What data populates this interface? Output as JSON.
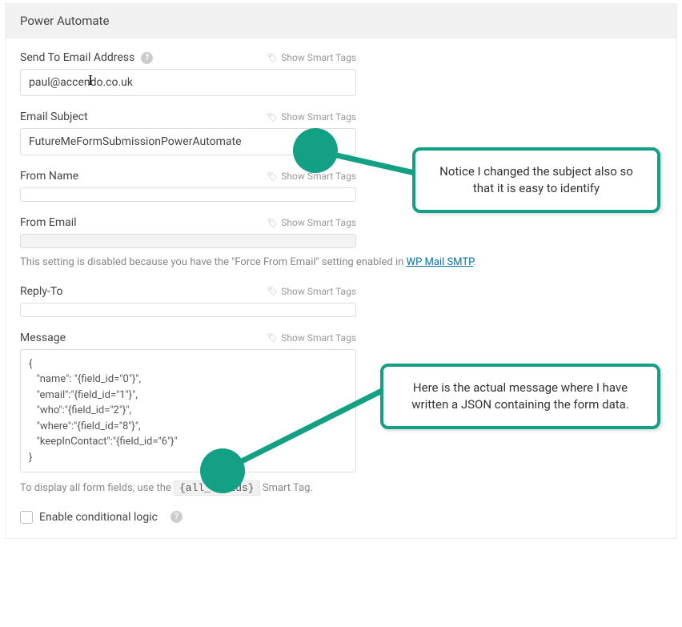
{
  "panel": {
    "title": "Power Automate"
  },
  "smartTagsLabel": "Show Smart Tags",
  "fields": {
    "sendTo": {
      "label": "Send To Email Address",
      "value": "paul@accendo.co.uk"
    },
    "subject": {
      "label": "Email Subject",
      "value": "FutureMeFormSubmissionPowerAutomate"
    },
    "fromName": {
      "label": "From Name",
      "value": ""
    },
    "fromEmail": {
      "label": "From Email",
      "value": "",
      "hintPrefix": "This setting is disabled because you have the \"Force From Email\" setting enabled in ",
      "hintLink": "WP Mail SMTP",
      "hintSuffix": "."
    },
    "replyTo": {
      "label": "Reply-To",
      "value": ""
    },
    "message": {
      "label": "Message",
      "value": "{\n   \"name\": \"{field_id=\"0\"}\",\n   \"email\":\"{field_id=\"1\"}\",\n   \"who\":\"{field_id=\"2\"}\",\n   \"where\":\"{field_id=\"8\"}\",\n   \"keepInContact\":\"{field_id=\"6\"}\"\n}",
      "footerPrefix": "To display all form fields, use the ",
      "footerCode": "{all_fields}",
      "footerSuffix": " Smart Tag."
    }
  },
  "conditional": {
    "label": "Enable conditional logic"
  },
  "annotations": {
    "subjectNote": "Notice I changed the subject also so that it is easy to identify",
    "messageNote": "Here is the actual message where I have written a JSON containing the form data."
  }
}
